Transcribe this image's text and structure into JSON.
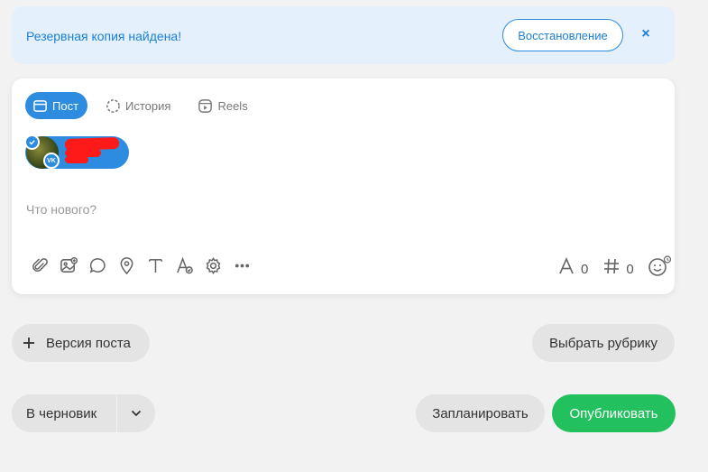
{
  "banner": {
    "message": "Резервная копия найдена!",
    "restore_label": "Восстановление",
    "close_symbol": "×"
  },
  "tabs": [
    {
      "label": "Пост",
      "icon": "post-icon",
      "active": true
    },
    {
      "label": "История",
      "icon": "story-icon",
      "active": false
    },
    {
      "label": "Reels",
      "icon": "reels-icon",
      "active": false
    }
  ],
  "account": {
    "network": "VK",
    "selected": true
  },
  "composer": {
    "placeholder": "Что нового?"
  },
  "toolbar": {
    "icons": [
      "attach-icon",
      "media-icon",
      "comment-icon",
      "location-icon",
      "text-icon",
      "font-style-icon",
      "settings-icon",
      "more-icon"
    ]
  },
  "counters": {
    "characters": "0",
    "hashtags": "0"
  },
  "actions": {
    "version_label": "Версия поста",
    "rubric_label": "Выбрать рубрику",
    "draft_label": "В черновик",
    "schedule_label": "Запланировать",
    "publish_label": "Опубликовать"
  },
  "colors": {
    "accent": "#2d8be0",
    "publish": "#23c05e",
    "banner_bg": "#e4f0fb"
  }
}
